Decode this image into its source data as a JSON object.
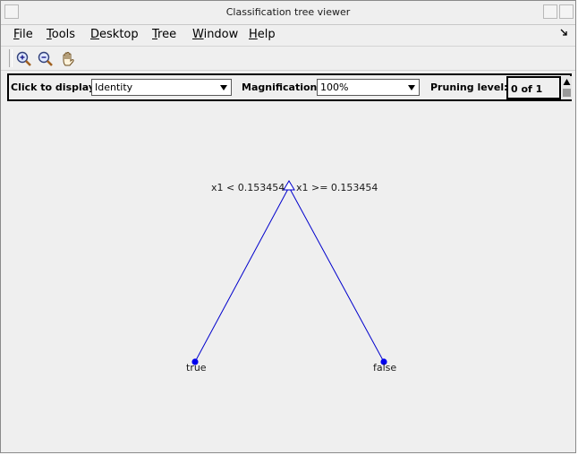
{
  "window": {
    "title": "Classification tree viewer"
  },
  "menubar": {
    "items": [
      {
        "mnemonic": "F",
        "rest": "ile"
      },
      {
        "mnemonic": "T",
        "rest": "ools"
      },
      {
        "mnemonic": "D",
        "rest": "esktop"
      },
      {
        "mnemonic": "T",
        "rest": "ree"
      },
      {
        "mnemonic": "W",
        "rest": "indow"
      },
      {
        "mnemonic": "H",
        "rest": "elp"
      }
    ],
    "dock_icon": "dock-arrow-icon"
  },
  "toolbar": {
    "tools": [
      "zoom-in-icon",
      "zoom-out-icon",
      "pan-hand-icon"
    ]
  },
  "controls": {
    "display_label": "Click to display:",
    "display_value": "Identity",
    "magnification_label": "Magnification:",
    "magnification_value": "100%",
    "pruning_label": "Pruning level:",
    "pruning_value": "0 of 1"
  },
  "tree": {
    "root": {
      "left_rule": "x1 < 0.153454",
      "right_rule": "x1 >= 0.153454"
    },
    "leaves": {
      "left": "true",
      "right": "false"
    },
    "colors": {
      "edge": "#0000cc",
      "leaf": "#0000ee"
    }
  }
}
